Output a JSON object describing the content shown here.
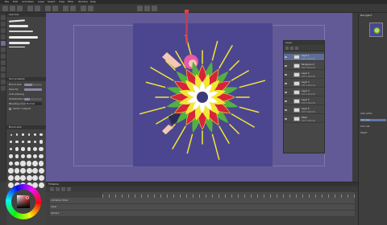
{
  "menu": {
    "items": [
      "File",
      "Edit",
      "Animation",
      "Layer",
      "Select",
      "View",
      "Filter",
      "Window",
      "Help"
    ]
  },
  "panels": {
    "brush_title": "Sub tool",
    "tool_property_title": "Tool property",
    "brush_size_title": "Brush size",
    "layer_tab": "Layer",
    "navigator_tab": "Navigator",
    "timeline_title": "Timeline",
    "timeline_track": "Animation folder"
  },
  "tool_property": {
    "rows": [
      "Brush size",
      "Opacity",
      "Anti-aliasing",
      "Stabilization",
      "Blending mode",
      "Vector magnet"
    ],
    "blending_value": "Normal",
    "brush_size_value": "10.0"
  },
  "layers": [
    {
      "name": "Layer 1",
      "mode": "100 % Normal"
    },
    {
      "name": "Background",
      "mode": "100 % Normal"
    },
    {
      "name": "Layer 2",
      "mode": "100 % Normal"
    },
    {
      "name": "Layer 3",
      "mode": "100 % Normal"
    },
    {
      "name": "Layer 4",
      "mode": "100 % Normal"
    },
    {
      "name": "Layer 5",
      "mode": "100 % Normal"
    },
    {
      "name": "Layer 6",
      "mode": "100 % Normal"
    },
    {
      "name": "Paper",
      "mode": "100 % Normal"
    }
  ],
  "right_panel": {
    "rows": [
      "Auto action",
      "Sub view",
      "Color set",
      "Object"
    ]
  },
  "timeline": {
    "tracks": [
      "Animation folder",
      "Layer",
      "Camera"
    ]
  },
  "colors": {
    "canvas_bg": "#615a96",
    "artboard": "#4c4691",
    "accent": "#d23a4a",
    "flower_yellow": "#f2e635",
    "flower_red": "#d8243a",
    "flower_green": "#53b042"
  }
}
